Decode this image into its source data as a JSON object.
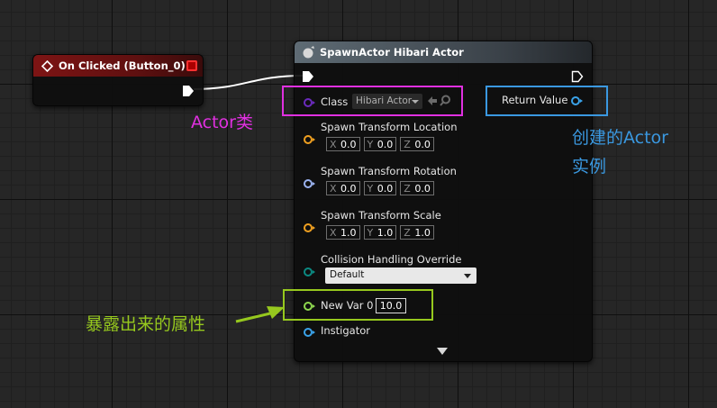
{
  "colors": {
    "class_pin": "#6b2bbd",
    "struct_pin": "#f0a020",
    "rotator_pin": "#9bb3f0",
    "enum_pin": "#0b8a82",
    "float_pin": "#8fd84f",
    "object_pin": "#3aa3ea",
    "class_annotation": "#e030e0",
    "return_annotation": "#3a98e0",
    "exposed_annotation": "#96c81e"
  },
  "event_node": {
    "icon": "event-diamond-icon",
    "title": "On Clicked (Button_0)"
  },
  "spawn_node": {
    "icon": "function-icon",
    "title": "SpawnActor Hibari Actor",
    "class_label": "Class",
    "class_value": "Hibari Actor",
    "return_label": "Return Value",
    "location_label": "Spawn Transform Location",
    "location": {
      "x": "0.0",
      "y": "0.0",
      "z": "0.0"
    },
    "rotation_label": "Spawn Transform Rotation",
    "rotation": {
      "x": "0.0",
      "y": "0.0",
      "z": "0.0"
    },
    "scale_label": "Spawn Transform Scale",
    "scale": {
      "x": "1.0",
      "y": "1.0",
      "z": "1.0"
    },
    "collision_label": "Collision Handling Override",
    "collision_value": "Default",
    "newvar_label": "New Var 0",
    "newvar_value": "10.0",
    "instigator_label": "Instigator",
    "axis": {
      "x": "X",
      "y": "Y",
      "z": "Z"
    }
  },
  "annotations": {
    "class": "Actor类",
    "return_line1": "创建的Actor",
    "return_line2": "实例",
    "exposed": "暴露出来的属性"
  }
}
